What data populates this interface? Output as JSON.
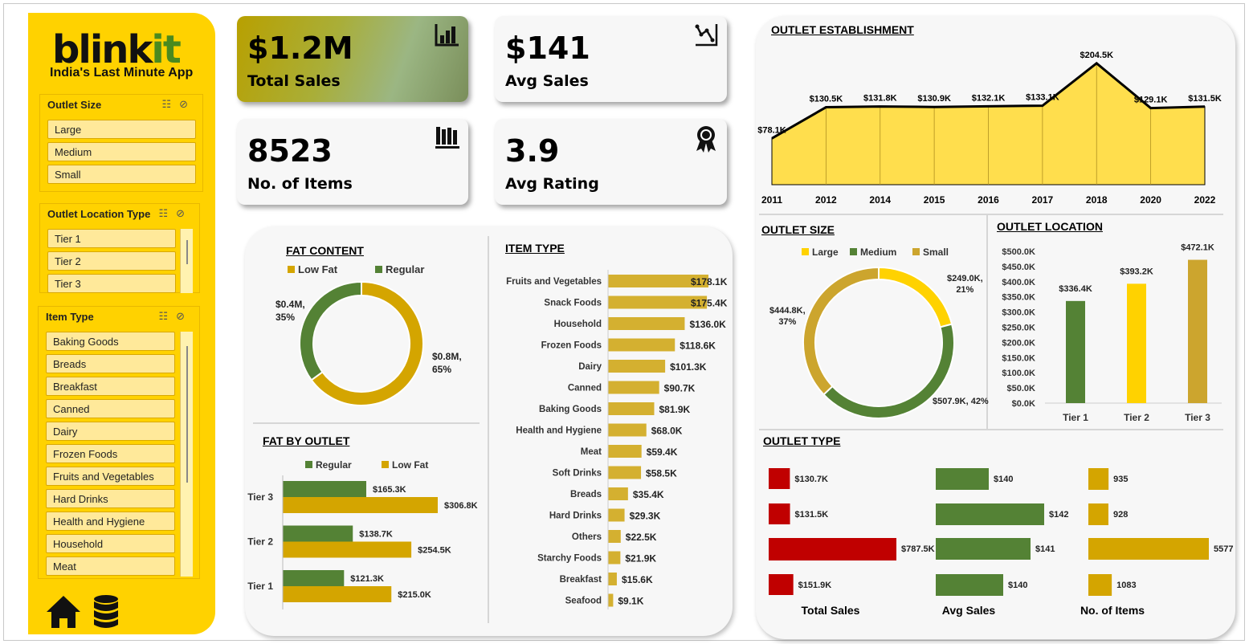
{
  "brand": {
    "logo_main": "blink",
    "logo_accent": "it",
    "tagline": "India's Last Minute App"
  },
  "colors": {
    "yellow": "#ffd200",
    "gold": "#d4a500",
    "green": "#548235",
    "red": "#c00000",
    "ochre": "#cca52e",
    "chart_fill": "#ffde4d"
  },
  "slicers": {
    "outlet_size": {
      "title": "Outlet Size",
      "items": [
        "Large",
        "Medium",
        "Small"
      ]
    },
    "outlet_location": {
      "title": "Outlet Location Type",
      "items": [
        "Tier 1",
        "Tier 2",
        "Tier 3"
      ]
    },
    "item_type": {
      "title": "Item Type",
      "items": [
        "Baking Goods",
        "Breads",
        "Breakfast",
        "Canned",
        "Dairy",
        "Frozen Foods",
        "Fruits and Vegetables",
        "Hard Drinks",
        "Health and Hygiene",
        "Household",
        "Meat"
      ]
    },
    "icons": [
      "multi-select-icon",
      "clear-filter-icon"
    ]
  },
  "nav": {
    "icons": [
      "home-icon",
      "database-icon"
    ]
  },
  "kpis": [
    {
      "value": "$1.2M",
      "label": "Total Sales",
      "icon": "bar-chart-icon"
    },
    {
      "value": "$141",
      "label": "Avg Sales",
      "icon": "line-chart-icon"
    },
    {
      "value": "8523",
      "label": "No. of Items",
      "icon": "books-icon"
    },
    {
      "value": "3.9",
      "label": "Avg Rating",
      "icon": "award-ribbon-icon"
    }
  ],
  "chart_data": [
    {
      "id": "outlet-establishment",
      "type": "area",
      "title": "OUTLET ESTABLISHMENT",
      "categories": [
        "2011",
        "2012",
        "2014",
        "2015",
        "2016",
        "2017",
        "2018",
        "2020",
        "2022"
      ],
      "values": [
        78.1,
        130.5,
        131.8,
        130.9,
        132.1,
        133.1,
        204.5,
        129.1,
        131.5
      ],
      "data_labels": [
        "$78.1K",
        "$130.5K",
        "$131.8K",
        "$130.9K",
        "$132.1K",
        "$133.1K",
        "$204.5K",
        "$129.1K",
        "$131.5K"
      ],
      "ylim": [
        0,
        230
      ]
    },
    {
      "id": "fat-content",
      "type": "pie",
      "title": "FAT CONTENT",
      "labels": [
        "Low Fat",
        "Regular"
      ],
      "values": [
        65,
        35
      ],
      "data_labels": [
        "$0.8M,\n65%",
        "$0.4M,\n35%"
      ]
    },
    {
      "id": "fat-by-outlet",
      "type": "bar",
      "title": "FAT BY OUTLET",
      "categories": [
        "Tier 3",
        "Tier 2",
        "Tier 1"
      ],
      "series": [
        {
          "name": "Regular",
          "values": [
            165.3,
            138.7,
            121.3
          ],
          "data_labels": [
            "$165.3K",
            "$138.7K",
            "$121.3K"
          ]
        },
        {
          "name": "Low Fat",
          "values": [
            306.8,
            254.5,
            215.0
          ],
          "data_labels": [
            "$306.8K",
            "$254.5K",
            "$215.0K"
          ]
        }
      ]
    },
    {
      "id": "item-type",
      "type": "bar",
      "title": "ITEM TYPE",
      "categories": [
        "Fruits and Vegetables",
        "Snack Foods",
        "Household",
        "Frozen Foods",
        "Dairy",
        "Canned",
        "Baking Goods",
        "Health and Hygiene",
        "Meat",
        "Soft Drinks",
        "Breads",
        "Hard Drinks",
        "Others",
        "Starchy Foods",
        "Breakfast",
        "Seafood"
      ],
      "values": [
        178.1,
        175.4,
        136.0,
        118.6,
        101.3,
        90.7,
        81.9,
        68.0,
        59.4,
        58.5,
        35.4,
        29.3,
        22.5,
        21.9,
        15.6,
        9.1
      ],
      "data_labels": [
        "$178.1K",
        "$175.4K",
        "$136.0K",
        "$118.6K",
        "$101.3K",
        "$90.7K",
        "$81.9K",
        "$68.0K",
        "$59.4K",
        "$58.5K",
        "$35.4K",
        "$29.3K",
        "$22.5K",
        "$21.9K",
        "$15.6K",
        "$9.1K"
      ]
    },
    {
      "id": "outlet-size",
      "type": "pie",
      "title": "OUTLET SIZE",
      "labels": [
        "Large",
        "Medium",
        "Small"
      ],
      "values": [
        21,
        42,
        37
      ],
      "data_labels": [
        "$249.0K,\n21%",
        "$507.9K, 42%",
        "$444.8K,\n37%"
      ]
    },
    {
      "id": "outlet-location",
      "type": "bar",
      "title": "OUTLET LOCATION",
      "categories": [
        "Tier 1",
        "Tier 2",
        "Tier 3"
      ],
      "values": [
        336.4,
        393.2,
        472.1
      ],
      "data_labels": [
        "$336.4K",
        "$393.2K",
        "$472.1K"
      ],
      "yticks": [
        "$500.0K",
        "$450.0K",
        "$400.0K",
        "$350.0K",
        "$300.0K",
        "$250.0K",
        "$200.0K",
        "$150.0K",
        "$100.0K",
        "$50.0K",
        "$0.0K"
      ],
      "ylim": [
        0,
        500
      ]
    },
    {
      "id": "outlet-type",
      "type": "table",
      "title": "OUTLET TYPE",
      "columns": [
        {
          "name": "Total Sales",
          "values": [
            130.7,
            131.5,
            787.5,
            151.9
          ],
          "data_labels": [
            "$130.7K",
            "$131.5K",
            "$787.5K",
            "$151.9K"
          ]
        },
        {
          "name": "Avg Sales",
          "values": [
            140,
            142,
            141,
            140
          ],
          "data_labels": [
            "$140",
            "$142",
            "$141",
            "$140"
          ]
        },
        {
          "name": "No. of Items",
          "values": [
            935,
            928,
            5577,
            1083
          ],
          "data_labels": [
            "935",
            "928",
            "5577",
            "1083"
          ]
        }
      ]
    }
  ]
}
